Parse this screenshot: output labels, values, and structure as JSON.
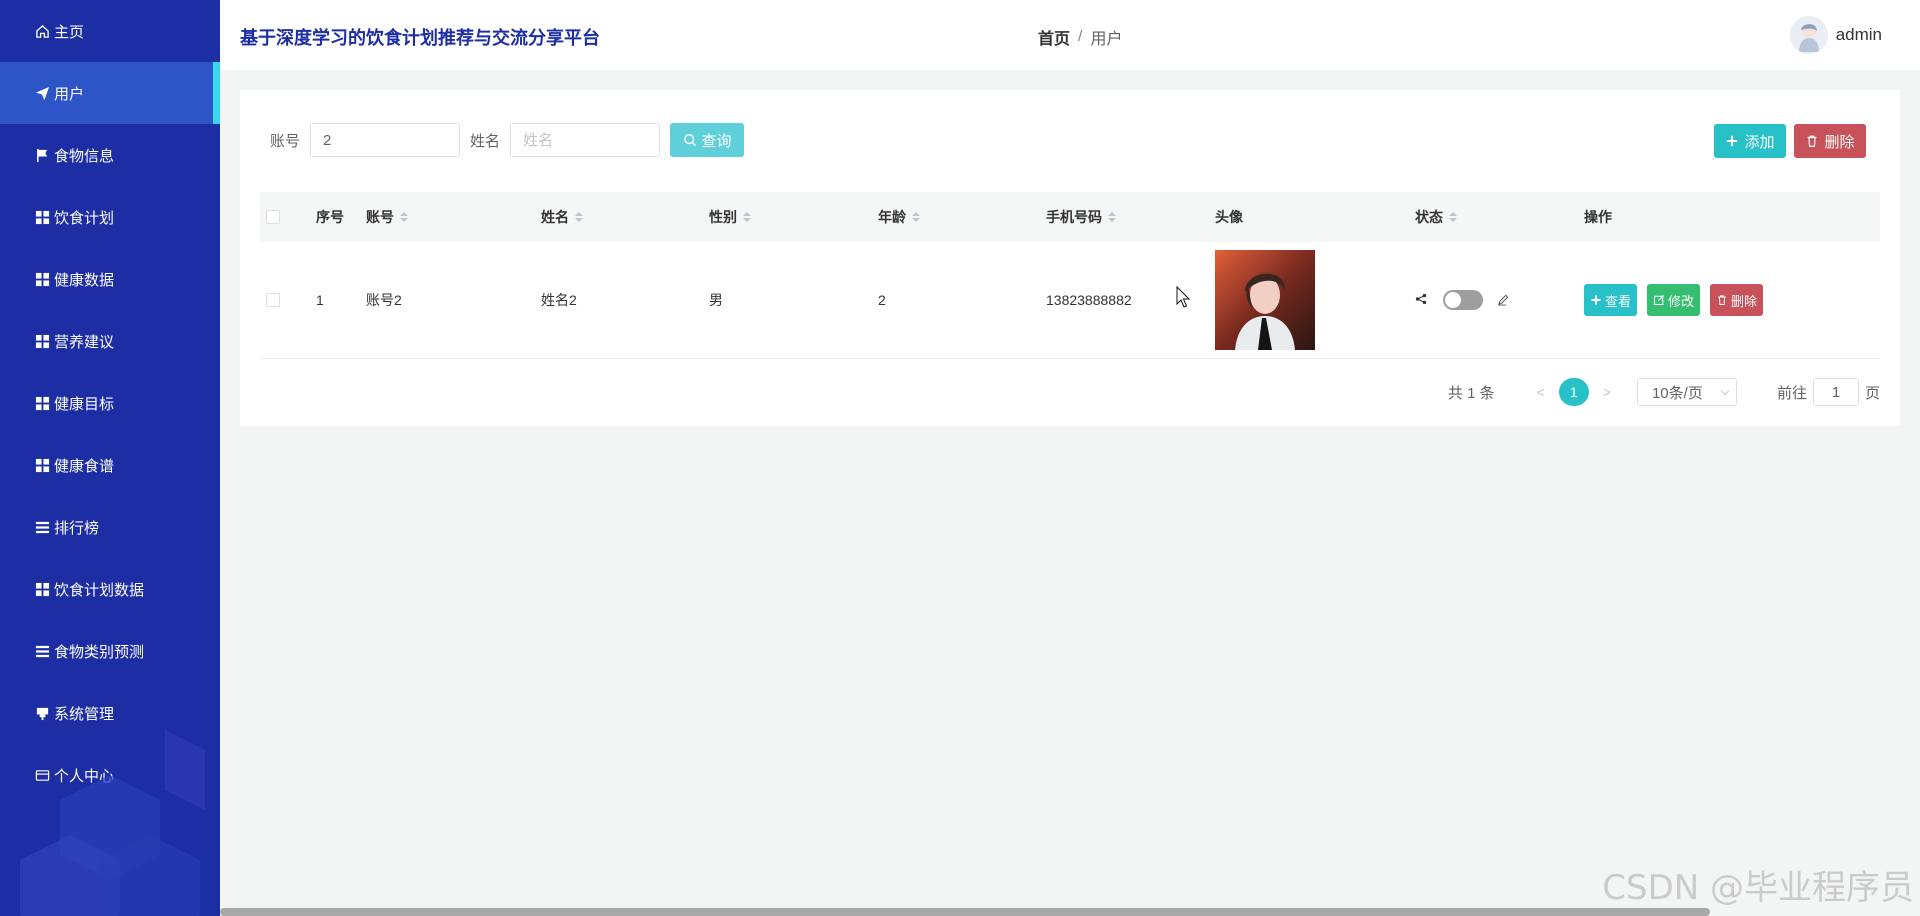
{
  "sidebar": {
    "items": [
      {
        "label": "主页",
        "icon": "home-icon"
      },
      {
        "label": "用户",
        "icon": "send-icon",
        "active": true
      },
      {
        "label": "食物信息",
        "icon": "flag-icon"
      },
      {
        "label": "饮食计划",
        "icon": "grid-icon"
      },
      {
        "label": "健康数据",
        "icon": "grid-icon"
      },
      {
        "label": "营养建议",
        "icon": "grid-icon"
      },
      {
        "label": "健康目标",
        "icon": "grid-icon"
      },
      {
        "label": "健康食谱",
        "icon": "grid-icon"
      },
      {
        "label": "排行榜",
        "icon": "list-icon"
      },
      {
        "label": "饮食计划数据",
        "icon": "grid-icon"
      },
      {
        "label": "食物类别预测",
        "icon": "list-icon"
      },
      {
        "label": "系统管理",
        "icon": "marker-icon"
      },
      {
        "label": "个人中心",
        "icon": "card-icon"
      }
    ]
  },
  "header": {
    "title": "基于深度学习的饮食计划推荐与交流分享平台",
    "breadcrumb_home": "首页",
    "breadcrumb_sep": "/",
    "breadcrumb_current": "用户",
    "username": "admin"
  },
  "search": {
    "account_label": "账号",
    "account_value": "2",
    "name_label": "姓名",
    "name_placeholder": "姓名",
    "query_button": "查询"
  },
  "actions": {
    "add_button": "添加",
    "delete_button": "删除"
  },
  "table": {
    "headers": {
      "index": "序号",
      "account": "账号",
      "name": "姓名",
      "sex": "性别",
      "age": "年龄",
      "phone": "手机号码",
      "avatar": "头像",
      "status": "状态",
      "ops": "操作"
    },
    "rows": [
      {
        "index": "1",
        "account": "账号2",
        "name": "姓名2",
        "sex": "男",
        "age": "2",
        "phone": "13823888882",
        "status_on": false,
        "view": "查看",
        "edit": "修改",
        "delete": "删除"
      }
    ]
  },
  "pagination": {
    "total": "共 1 条",
    "prev": "<",
    "current_page": "1",
    "next": ">",
    "page_size": "10条/页",
    "goto_prefix": "前往",
    "goto_value": "1",
    "goto_suffix": "页"
  },
  "watermark": "CSDN @毕业程序员",
  "colors": {
    "sidebar_bg": "#1d2ea5",
    "sidebar_active": "#2d55c8",
    "accent": "#27c1c7",
    "danger": "#c8525a",
    "success": "#35be6f"
  }
}
